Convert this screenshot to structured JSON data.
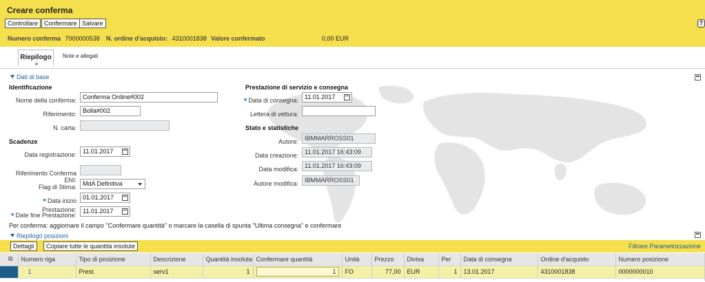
{
  "header": {
    "title": "Creare conferma",
    "buttons": [
      "Controllare",
      "Confermare",
      "Salvare"
    ],
    "help_icon": "help-icon",
    "fields": [
      {
        "label": "Numero conferma",
        "value": "7000000538"
      },
      {
        "label": "N. ordine d'acquisto:",
        "value": "4310001838"
      },
      {
        "label": "Valore confermato",
        "value": "0,00 EUR"
      }
    ]
  },
  "tabs": [
    {
      "label": "Riepilogo",
      "active": true
    },
    {
      "label": "Note e allegati",
      "active": false
    }
  ],
  "base": {
    "section_label": "Dati di base",
    "identificazione": {
      "title": "Identificazione",
      "nome_label": "Nome della conferma:",
      "nome_value": "Conferma Ordine#002",
      "riferimento_label": "Riferimento:",
      "riferimento_value": "Bolla#002",
      "carta_label": "N. carta:",
      "carta_value": ""
    },
    "scadenze": {
      "title": "Scadenze",
      "registrazione_label": "Data registrazione:",
      "registrazione_value": "11.01.2017",
      "rif_eni_label": "Riferimento Conferma ENI:",
      "rif_eni_value": "",
      "flag_label": "Flag di Stima:",
      "flag_value": "MdA Definitiva",
      "inizio_label": "Data inizio Prestazione:",
      "inizio_value": "01.01.2017",
      "fine_label": "Date fine Prestazione:",
      "fine_value": "11.01.2017"
    },
    "prestazione": {
      "title": "Prestazione di servizio e consegna",
      "consegna_label": "Data di consegna:",
      "consegna_value": "11.01.2017",
      "vettura_label": "Lettera di vettura:",
      "vettura_value": ""
    },
    "stato": {
      "title": "Stato e statistiche",
      "autore_label": "Autore:",
      "autore_value": "IBMMARROSS01",
      "creazione_label": "Data creazione:",
      "creazione_value": "11.01.2017 16:43:09",
      "modifica_label": "Data modifica:",
      "modifica_value": "11.01.2017 16:43:09",
      "autore_mod_label": "Autore modifica:",
      "autore_mod_value": "IBMMARROSS01"
    }
  },
  "note": "Per conferma: aggiornare il campo \"Confermare quantità\" o marcare la casella di spunta \"Ultima consegna\" e confermare",
  "positions": {
    "section_label": "Riepilogo posizioni",
    "buttons": [
      "Dettagli",
      "Copiare tutte le quantità insolute"
    ],
    "filter_link": "Filtrare Parametrizzazione",
    "columns": [
      "Numero riga",
      "Tipo di posizione",
      "Descrizione",
      "Quantità insoluta",
      "Confermare quantità",
      "Unità",
      "Prezzo",
      "Divisa",
      "Per",
      "Data di consegna",
      "Ordine d'acquisto",
      "Numero posizione"
    ],
    "rows": [
      [
        "1",
        "Prest.",
        "serv1",
        "1",
        "1",
        "FO",
        "77,00",
        "EUR",
        "1",
        "13.01.2017",
        "4310001838",
        "0000000010"
      ]
    ]
  },
  "colors": {
    "header_bg": "#f5df4d",
    "link": "#1f5f9e",
    "selected_row": "#f4f1a7",
    "row_selector": "#1c5f8a"
  }
}
